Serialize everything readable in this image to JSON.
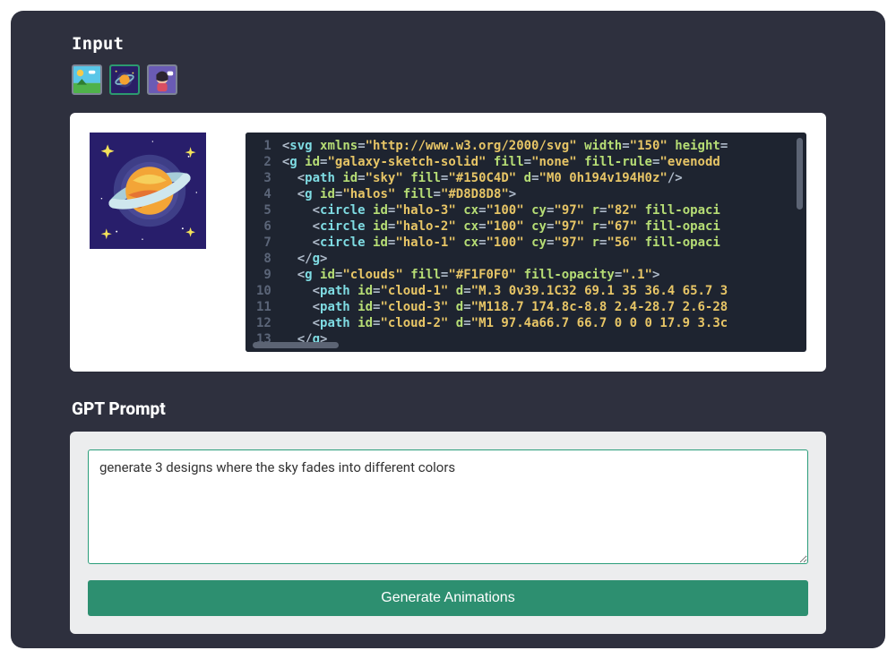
{
  "sections": {
    "input_title": "Input",
    "prompt_title": "GPT Prompt"
  },
  "thumbnails": [
    {
      "name": "landscape-thumb"
    },
    {
      "name": "galaxy-thumb"
    },
    {
      "name": "avatar-thumb"
    }
  ],
  "selected_thumb_index": 1,
  "code": {
    "lines": [
      "<svg xmlns=\"http://www.w3.org/2000/svg\" width=\"150\" height=",
      "<g id=\"galaxy-sketch-solid\" fill=\"none\" fill-rule=\"evenodd",
      "  <path id=\"sky\" fill=\"#150C4D\" d=\"M0 0h194v194H0z\"/>",
      "  <g id=\"halos\" fill=\"#D8D8D8\">",
      "    <circle id=\"halo-3\" cx=\"100\" cy=\"97\" r=\"82\" fill-opaci",
      "    <circle id=\"halo-2\" cx=\"100\" cy=\"97\" r=\"67\" fill-opaci",
      "    <circle id=\"halo-1\" cx=\"100\" cy=\"97\" r=\"56\" fill-opaci",
      "  </g>",
      "  <g id=\"clouds\" fill=\"#F1F0F0\" fill-opacity=\".1\">",
      "    <path id=\"cloud-1\" d=\"M.3 0v39.1C32 69.1 35 36.4 65.7 3",
      "    <path id=\"cloud-3\" d=\"M118.7 174.8c-8.8 2.4-28.7 2.6-28",
      "    <path id=\"cloud-2\" d=\"M1 97.4a66.7 66.7 0 0 0 17.9 3.3c",
      "  </g>"
    ],
    "start_line": 1
  },
  "prompt": {
    "value": "generate 3 designs where the sky fades into different colors",
    "placeholder": ""
  },
  "buttons": {
    "generate": "Generate Animations"
  },
  "colors": {
    "app_bg": "#2e303e",
    "accent": "#2d8f70",
    "code_bg": "#1e2430"
  }
}
